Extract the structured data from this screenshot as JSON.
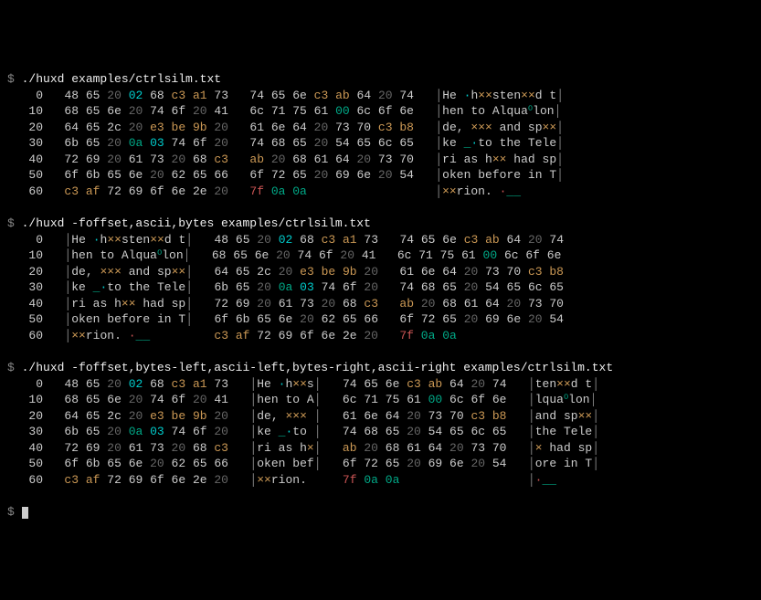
{
  "prompt": "$ ",
  "commands": [
    "./huxd examples/ctrlsilm.txt",
    "./huxd -foffset,ascii,bytes examples/ctrlsilm.txt",
    "./huxd -foffset,bytes-left,ascii-left,bytes-right,ascii-right examples/ctrlsilm.txt"
  ],
  "sep": "│",
  "offsets": [
    "0",
    "10",
    "20",
    "30",
    "40",
    "50",
    "60"
  ],
  "rows": [
    [
      [
        "48",
        "d"
      ],
      [
        "65",
        "d"
      ],
      [
        "20",
        "sp"
      ],
      [
        "02",
        "ct"
      ],
      [
        "68",
        "d"
      ],
      [
        "c3",
        "hi"
      ],
      [
        "a1",
        "hi"
      ],
      [
        "73",
        "d"
      ],
      [
        "74",
        "d"
      ],
      [
        "65",
        "d"
      ],
      [
        "6e",
        "d"
      ],
      [
        "c3",
        "hi"
      ],
      [
        "ab",
        "hi"
      ],
      [
        "64",
        "d"
      ],
      [
        "20",
        "sp"
      ],
      [
        "74",
        "d"
      ]
    ],
    [
      [
        "68",
        "d"
      ],
      [
        "65",
        "d"
      ],
      [
        "6e",
        "d"
      ],
      [
        "20",
        "sp"
      ],
      [
        "74",
        "d"
      ],
      [
        "6f",
        "d"
      ],
      [
        "20",
        "sp"
      ],
      [
        "41",
        "d"
      ],
      [
        "6c",
        "d"
      ],
      [
        "71",
        "d"
      ],
      [
        "75",
        "d"
      ],
      [
        "61",
        "d"
      ],
      [
        "00",
        "nl"
      ],
      [
        "6c",
        "d"
      ],
      [
        "6f",
        "d"
      ],
      [
        "6e",
        "d"
      ]
    ],
    [
      [
        "64",
        "d"
      ],
      [
        "65",
        "d"
      ],
      [
        "2c",
        "d"
      ],
      [
        "20",
        "sp"
      ],
      [
        "e3",
        "hi"
      ],
      [
        "be",
        "hi"
      ],
      [
        "9b",
        "hi"
      ],
      [
        "20",
        "sp"
      ],
      [
        "61",
        "d"
      ],
      [
        "6e",
        "d"
      ],
      [
        "64",
        "d"
      ],
      [
        "20",
        "sp"
      ],
      [
        "73",
        "d"
      ],
      [
        "70",
        "d"
      ],
      [
        "c3",
        "hi"
      ],
      [
        "b8",
        "hi"
      ]
    ],
    [
      [
        "6b",
        "d"
      ],
      [
        "65",
        "d"
      ],
      [
        "20",
        "sp"
      ],
      [
        "0a",
        "nl"
      ],
      [
        "03",
        "ct"
      ],
      [
        "74",
        "d"
      ],
      [
        "6f",
        "d"
      ],
      [
        "20",
        "sp"
      ],
      [
        "74",
        "d"
      ],
      [
        "68",
        "d"
      ],
      [
        "65",
        "d"
      ],
      [
        "20",
        "sp"
      ],
      [
        "54",
        "d"
      ],
      [
        "65",
        "d"
      ],
      [
        "6c",
        "d"
      ],
      [
        "65",
        "d"
      ]
    ],
    [
      [
        "72",
        "d"
      ],
      [
        "69",
        "d"
      ],
      [
        "20",
        "sp"
      ],
      [
        "61",
        "d"
      ],
      [
        "73",
        "d"
      ],
      [
        "20",
        "sp"
      ],
      [
        "68",
        "d"
      ],
      [
        "c3",
        "hi"
      ],
      [
        "ab",
        "hi"
      ],
      [
        "20",
        "sp"
      ],
      [
        "68",
        "d"
      ],
      [
        "61",
        "d"
      ],
      [
        "64",
        "d"
      ],
      [
        "20",
        "sp"
      ],
      [
        "73",
        "d"
      ],
      [
        "70",
        "d"
      ]
    ],
    [
      [
        "6f",
        "d"
      ],
      [
        "6b",
        "d"
      ],
      [
        "65",
        "d"
      ],
      [
        "6e",
        "d"
      ],
      [
        "20",
        "sp"
      ],
      [
        "62",
        "d"
      ],
      [
        "65",
        "d"
      ],
      [
        "66",
        "d"
      ],
      [
        "6f",
        "d"
      ],
      [
        "72",
        "d"
      ],
      [
        "65",
        "d"
      ],
      [
        "20",
        "sp"
      ],
      [
        "69",
        "d"
      ],
      [
        "6e",
        "d"
      ],
      [
        "20",
        "sp"
      ],
      [
        "54",
        "d"
      ]
    ],
    [
      [
        "c3",
        "hi"
      ],
      [
        "af",
        "hi"
      ],
      [
        "72",
        "d"
      ],
      [
        "69",
        "d"
      ],
      [
        "6f",
        "d"
      ],
      [
        "6e",
        "d"
      ],
      [
        "2e",
        "d"
      ],
      [
        "20",
        "sp"
      ],
      [
        "7f",
        "hf"
      ],
      [
        "0a",
        "nl"
      ],
      [
        "0a",
        "nl"
      ]
    ]
  ],
  "ascii": [
    [
      [
        "H",
        "d"
      ],
      [
        "e",
        "d"
      ],
      [
        " ",
        "sp"
      ],
      [
        "·",
        "ct"
      ],
      [
        "h",
        "d"
      ],
      [
        "×",
        "hi"
      ],
      [
        "×",
        "hi"
      ],
      [
        "s",
        "d"
      ],
      [
        "t",
        "d"
      ],
      [
        "e",
        "d"
      ],
      [
        "n",
        "d"
      ],
      [
        "×",
        "hi"
      ],
      [
        "×",
        "hi"
      ],
      [
        "d",
        "d"
      ],
      [
        " ",
        "sp"
      ],
      [
        "t",
        "d"
      ]
    ],
    [
      [
        "h",
        "d"
      ],
      [
        "e",
        "d"
      ],
      [
        "n",
        "d"
      ],
      [
        " ",
        "sp"
      ],
      [
        "t",
        "d"
      ],
      [
        "o",
        "d"
      ],
      [
        " ",
        "sp"
      ],
      [
        "A",
        "d"
      ],
      [
        "l",
        "d"
      ],
      [
        "q",
        "d"
      ],
      [
        "u",
        "d"
      ],
      [
        "a",
        "d"
      ],
      [
        "⁰",
        "nl"
      ],
      [
        "l",
        "d"
      ],
      [
        "o",
        "d"
      ],
      [
        "n",
        "d"
      ]
    ],
    [
      [
        "d",
        "d"
      ],
      [
        "e",
        "d"
      ],
      [
        ",",
        "d"
      ],
      [
        " ",
        "sp"
      ],
      [
        "×",
        "hi"
      ],
      [
        "×",
        "hi"
      ],
      [
        "×",
        "hi"
      ],
      [
        " ",
        "sp"
      ],
      [
        "a",
        "d"
      ],
      [
        "n",
        "d"
      ],
      [
        "d",
        "d"
      ],
      [
        " ",
        "sp"
      ],
      [
        "s",
        "d"
      ],
      [
        "p",
        "d"
      ],
      [
        "×",
        "hi"
      ],
      [
        "×",
        "hi"
      ]
    ],
    [
      [
        "k",
        "d"
      ],
      [
        "e",
        "d"
      ],
      [
        " ",
        "sp"
      ],
      [
        "_",
        "nl"
      ],
      [
        "·",
        "ct"
      ],
      [
        "t",
        "d"
      ],
      [
        "o",
        "d"
      ],
      [
        " ",
        "sp"
      ],
      [
        "t",
        "d"
      ],
      [
        "h",
        "d"
      ],
      [
        "e",
        "d"
      ],
      [
        " ",
        "sp"
      ],
      [
        "T",
        "d"
      ],
      [
        "e",
        "d"
      ],
      [
        "l",
        "d"
      ],
      [
        "e",
        "d"
      ]
    ],
    [
      [
        "r",
        "d"
      ],
      [
        "i",
        "d"
      ],
      [
        " ",
        "sp"
      ],
      [
        "a",
        "d"
      ],
      [
        "s",
        "d"
      ],
      [
        " ",
        "sp"
      ],
      [
        "h",
        "d"
      ],
      [
        "×",
        "hi"
      ],
      [
        "×",
        "hi"
      ],
      [
        " ",
        "sp"
      ],
      [
        "h",
        "d"
      ],
      [
        "a",
        "d"
      ],
      [
        "d",
        "d"
      ],
      [
        " ",
        "sp"
      ],
      [
        "s",
        "d"
      ],
      [
        "p",
        "d"
      ]
    ],
    [
      [
        "o",
        "d"
      ],
      [
        "k",
        "d"
      ],
      [
        "e",
        "d"
      ],
      [
        "n",
        "d"
      ],
      [
        " ",
        "sp"
      ],
      [
        "b",
        "d"
      ],
      [
        "e",
        "d"
      ],
      [
        "f",
        "d"
      ],
      [
        "o",
        "d"
      ],
      [
        "r",
        "d"
      ],
      [
        "e",
        "d"
      ],
      [
        " ",
        "sp"
      ],
      [
        "i",
        "d"
      ],
      [
        "n",
        "d"
      ],
      [
        " ",
        "sp"
      ],
      [
        "T",
        "d"
      ]
    ],
    [
      [
        "×",
        "hi"
      ],
      [
        "×",
        "hi"
      ],
      [
        "r",
        "d"
      ],
      [
        "i",
        "d"
      ],
      [
        "o",
        "d"
      ],
      [
        "n",
        "d"
      ],
      [
        ".",
        "d"
      ],
      [
        " ",
        "sp"
      ],
      [
        "·",
        "hf"
      ],
      [
        "_",
        "nl"
      ],
      [
        "_",
        "nl"
      ]
    ]
  ]
}
